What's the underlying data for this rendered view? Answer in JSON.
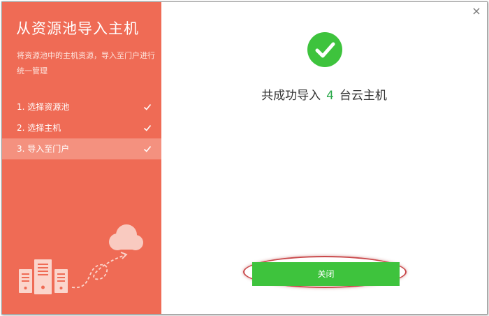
{
  "sidebar": {
    "title": "从资源池导入主机",
    "description": "将资源池中的主机资源，导入至门户进行统一管理",
    "steps": [
      {
        "label": "1. 选择资源池"
      },
      {
        "label": "2. 选择主机"
      },
      {
        "label": "3. 导入至门户"
      }
    ],
    "active_step": 3
  },
  "main": {
    "result_prefix": "共成功导入",
    "result_count": "4",
    "result_suffix": "台云主机",
    "close_button": "关闭"
  },
  "colors": {
    "sidebar_bg": "#ef6b55",
    "active_step_bg": "#f4917f",
    "success_green": "#3ec33d",
    "count_green": "#2aa84a"
  },
  "icons": {
    "close": "close-icon",
    "success": "check-circle-icon",
    "step_done": "checkmark-icon"
  }
}
